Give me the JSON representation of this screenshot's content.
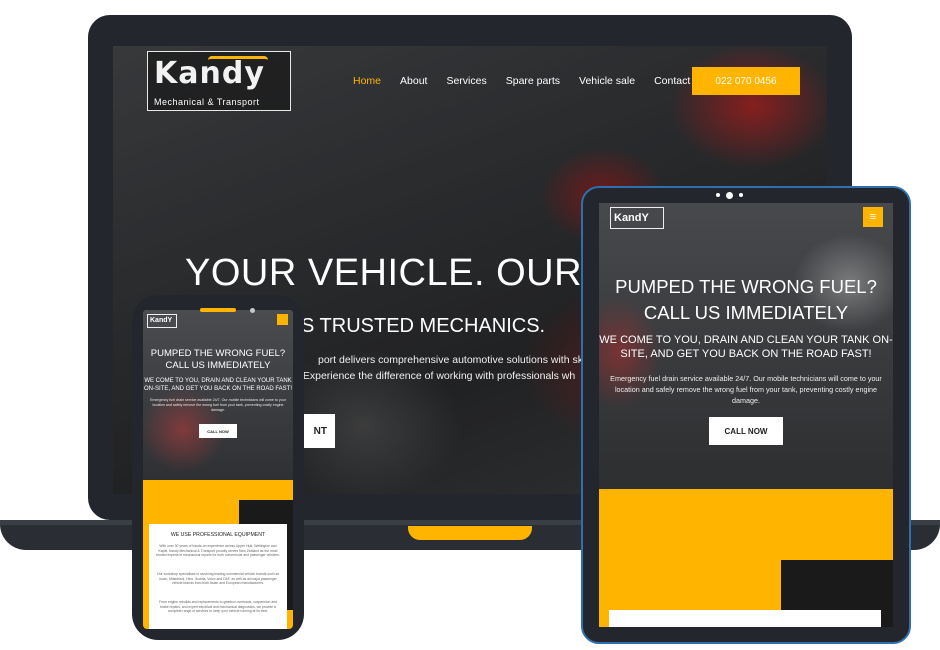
{
  "laptop": {
    "logo": {
      "brand": "Kandy",
      "tagline": "Mechanical & Transport"
    },
    "nav": [
      "Home",
      "About",
      "Services",
      "Spare parts",
      "Vehicle sale",
      "Contact"
    ],
    "active_nav": "Home",
    "phone_button": "022 070 0456",
    "hero": {
      "title": "YOUR VEHICLE. OUR P",
      "subtitle": "S TRUSTED MECHANICS.",
      "paragraph_line1": "port delivers comprehensive automotive solutions with skilled t",
      "paragraph_line2": "ing. Experience the difference of working with professionals wh",
      "cta": "NT"
    }
  },
  "phone": {
    "logo": "KandY",
    "hero": {
      "title_line1": "PUMPED THE WRONG FUEL?",
      "title_line2": "CALL US IMMEDIATELY",
      "subtitle": "WE COME TO YOU, DRAIN AND CLEAN YOUR TANK ON-SITE, AND GET YOU BACK ON THE ROAD FAST!",
      "paragraph": "Emergency fuel drain service available 24/7. Our mobile technicians will come to your location and safely remove the wrong fuel from your tank, preventing costly engine damage.",
      "cta": "CALL NOW"
    },
    "card": {
      "title": "WE USE PROFESSIONAL EQUIPMENT",
      "paragraphs": [
        "With over 30 years of hands-on experience across Upper Hutt, Wellington and Kapiti, Kandy Mechanical & Transport proudly serves New Zealand as the most trusted experts in mechanical repairs for both commercial and passenger vehicles.",
        "Our workshop specialises in servicing leading commercial vehicle brands such as Isuzu, Mitsubishi, Hino, Scania, Volvo and DAF, as well as all major passenger vehicle brands from both Asian and European manufacturers.",
        "From engine rebuilds and replacements to gearbox overhauls, suspension and brake repairs, and expert electrical and mechanical diagnostics, we provide a complete range of services to keep your vehicle running at its best."
      ]
    }
  },
  "tablet": {
    "logo": "KandY",
    "menu_icon": "hamburger-icon",
    "hero": {
      "title_line1": "PUMPED THE WRONG FUEL?",
      "title_line2": "CALL US IMMEDIATELY",
      "subtitle": "WE COME TO YOU, DRAIN AND CLEAN YOUR TANK ON-SITE, AND GET YOU BACK ON THE ROAD FAST!",
      "paragraph": "Emergency fuel drain service available 24/7. Our mobile technicians will come to your location and safely remove the wrong fuel from your tank, preventing costly engine damage.",
      "cta": "CALL NOW"
    }
  },
  "colors": {
    "accent": "#ffb400",
    "device_frame": "#23272d",
    "tablet_border": "#2f6fae"
  }
}
